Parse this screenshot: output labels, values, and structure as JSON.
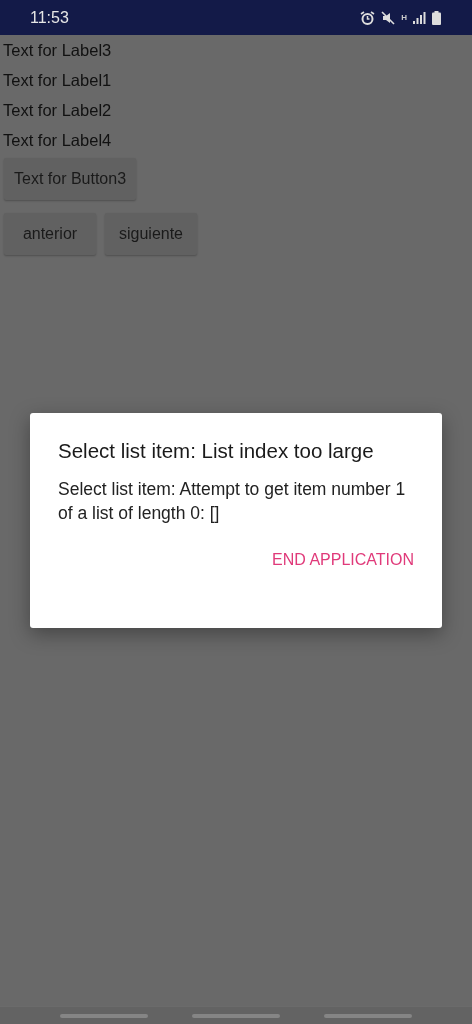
{
  "status_bar": {
    "time": "11:53",
    "network_type": "H"
  },
  "labels": [
    "Text for Label3",
    "Text for Label1",
    "Text for Label2",
    "Text for Label4"
  ],
  "buttons": [
    "Text for Button3"
  ],
  "nav_buttons": [
    "anterior",
    "siguiente"
  ],
  "dialog": {
    "title": "Select list item: List index too large",
    "message": "Select list item: Attempt to get item number 1 of a list of length 0: []",
    "action": "END APPLICATION"
  }
}
